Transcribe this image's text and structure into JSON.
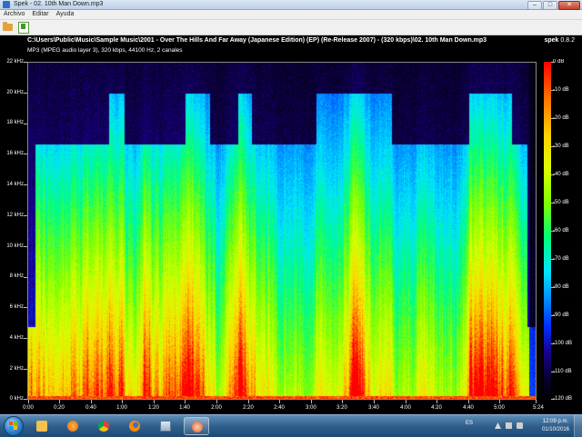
{
  "window": {
    "title": "Spek - 02. 10th Man Down.mp3",
    "minimize": "–",
    "maximize": "□",
    "close": "✕"
  },
  "menu": [
    "Archivo",
    "Editar",
    "Ayuda"
  ],
  "toolbar": {
    "open_icon": "folder-open-icon",
    "save_icon": "save-image-icon"
  },
  "spectrogram": {
    "file_path": "C:\\Users\\Public\\Music\\Sample Music\\2001 - Over The Hills And Far Away (Japanese Edition) (EP) (Re-Release 2007) - (320 kbps)\\02. 10th Man Down.mp3",
    "info": "MP3 (MPEG audio layer 3), 320 kbps, 44100 Hz, 2 canales",
    "brand_name": "spek",
    "brand_version": "0.8.2",
    "freq_labels": [
      "22 kHz",
      "20 kHz",
      "18 kHz",
      "16 kHz",
      "14 kHz",
      "12 kHz",
      "10 kHz",
      "8 kHz",
      "6 kHz",
      "4 kHz",
      "2 kHz",
      "0 kHz"
    ],
    "time_labels": [
      "0:00",
      "0:20",
      "0:40",
      "1:00",
      "1:20",
      "1:40",
      "2:00",
      "2:20",
      "2:40",
      "3:00",
      "3:20",
      "3:40",
      "4:00",
      "4:20",
      "4:40",
      "5:00",
      "5:24"
    ],
    "db_labels": [
      "0 dB",
      "-10 dB",
      "-20 dB",
      "-30 dB",
      "-40 dB",
      "-50 dB",
      "-60 dB",
      "-70 dB",
      "-80 dB",
      "-90 dB",
      "-100 dB",
      "-110 dB",
      "-120 dB"
    ]
  },
  "taskbar": {
    "apps": [
      "start-orb",
      "explorer-icon",
      "media-player-icon",
      "chrome-icon",
      "firefox-icon",
      "generic-app-icon",
      "spek-icon"
    ],
    "language": "ES",
    "time": "12:09 p.m.",
    "date": "01/10/2016"
  }
}
